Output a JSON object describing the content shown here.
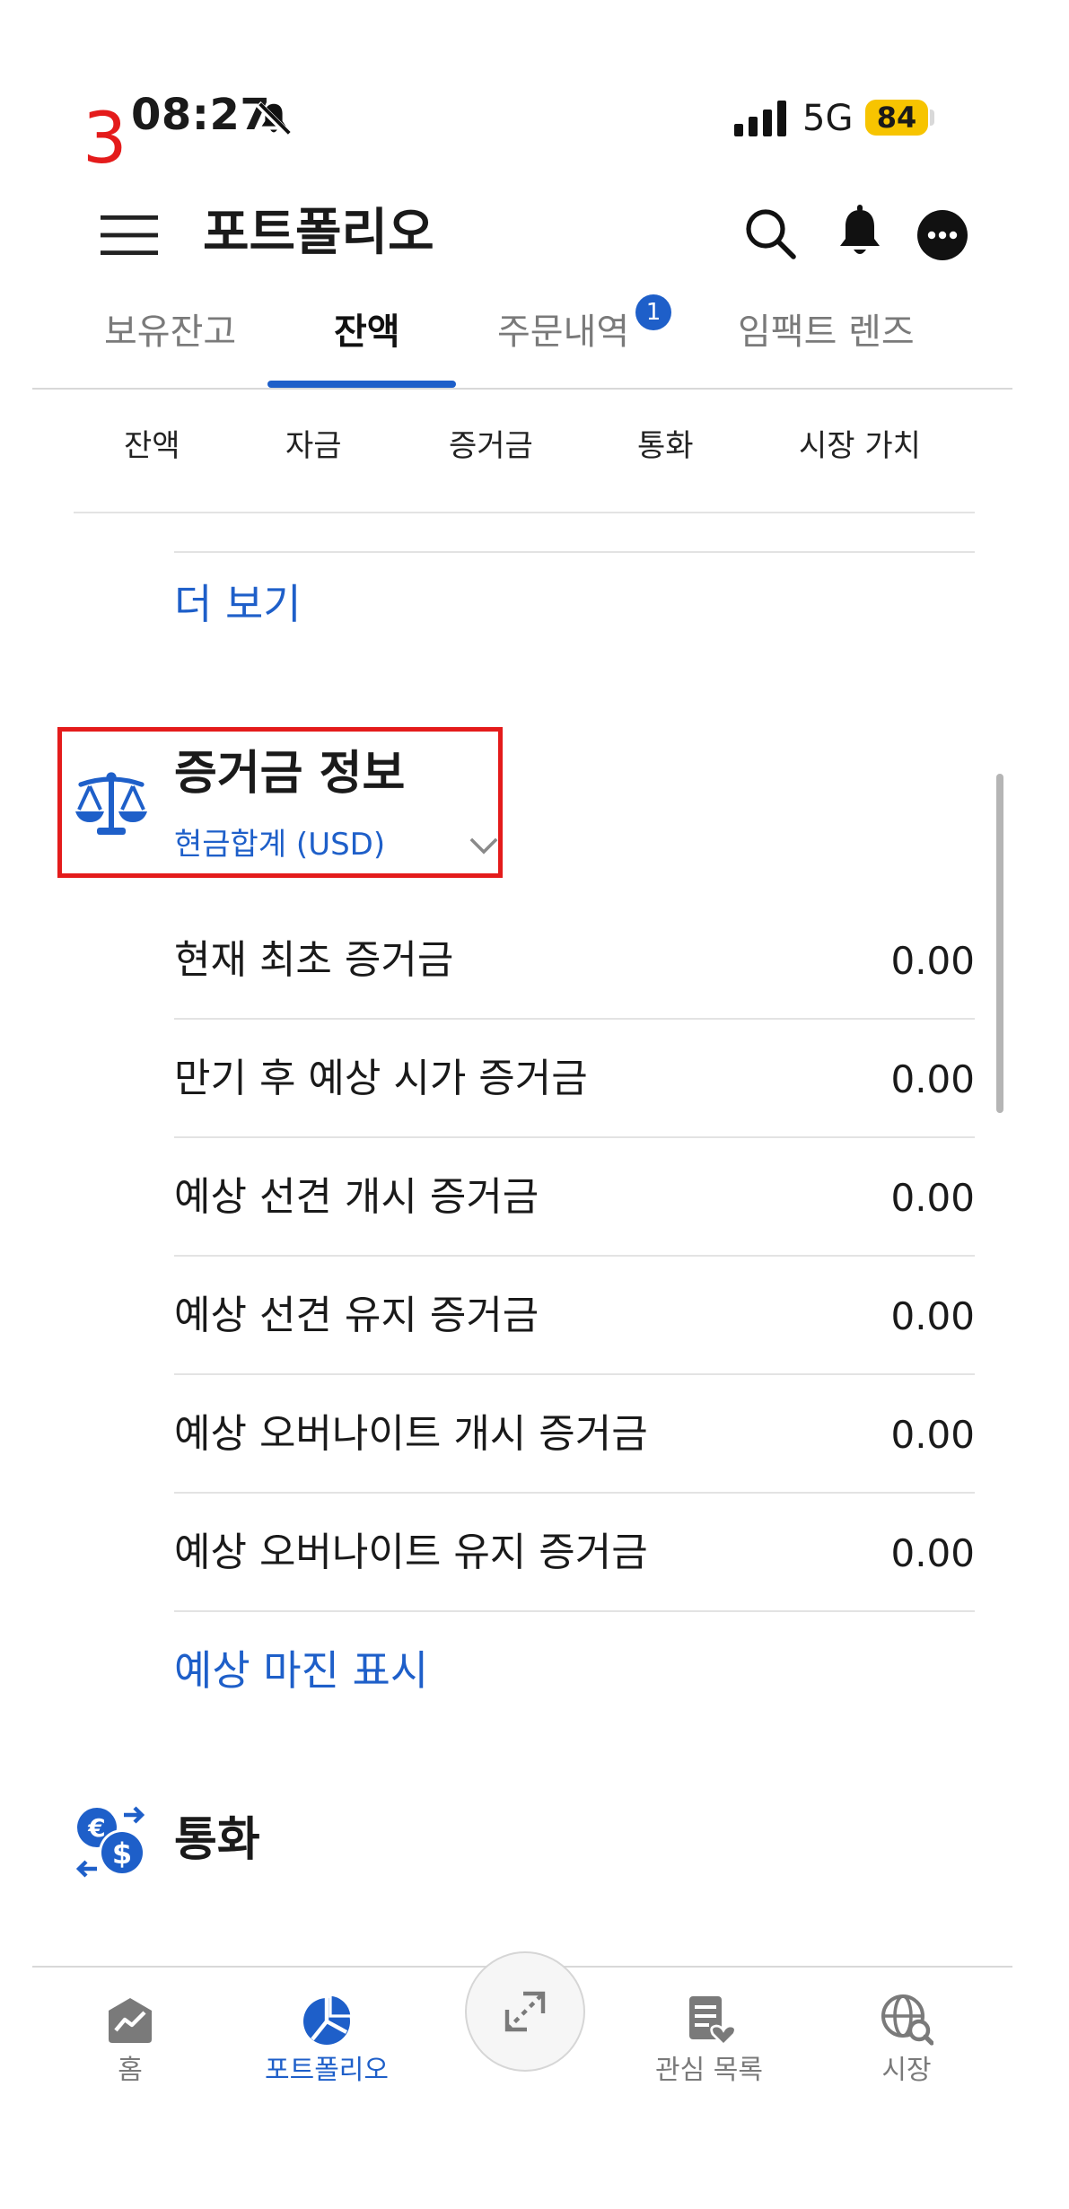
{
  "annotation": "3",
  "status_bar": {
    "time": "08:27",
    "network": "5G",
    "battery": "84"
  },
  "header": {
    "title": "포트폴리오"
  },
  "tabs": [
    {
      "label": "보유잔고"
    },
    {
      "label": "잔액",
      "active": true
    },
    {
      "label": "주문내역",
      "badge": "1"
    },
    {
      "label": "임팩트 렌즈"
    }
  ],
  "subtabs": [
    "잔액",
    "자금",
    "증거금",
    "통화",
    "시장 가치"
  ],
  "more_link": "더 보기",
  "margin_section": {
    "title": "증거금 정보",
    "currency_select": "현금합계 (USD)",
    "rows": [
      {
        "label": "현재 최초 증거금",
        "value": "0.00"
      },
      {
        "label": "만기 후 예상 시가 증거금",
        "value": "0.00"
      },
      {
        "label": "예상 선견 개시 증거금",
        "value": "0.00"
      },
      {
        "label": "예상 선견 유지 증거금",
        "value": "0.00"
      },
      {
        "label": "예상 오버나이트 개시 증거금",
        "value": "0.00"
      },
      {
        "label": "예상 오버나이트 유지 증거금",
        "value": "0.00"
      }
    ],
    "link": "예상 마진 표시"
  },
  "currency_section": {
    "title": "통화"
  },
  "bottom_nav": [
    {
      "label": "홈",
      "icon": "chart-home-icon"
    },
    {
      "label": "포트폴리오",
      "icon": "pie-chart-icon",
      "active": true
    },
    {
      "label": "관심 목록",
      "icon": "watchlist-icon"
    },
    {
      "label": "시장",
      "icon": "globe-search-icon"
    }
  ],
  "colors": {
    "accent": "#1e5fc9",
    "annotation": "#e41b1b",
    "battery": "#f7c400"
  }
}
